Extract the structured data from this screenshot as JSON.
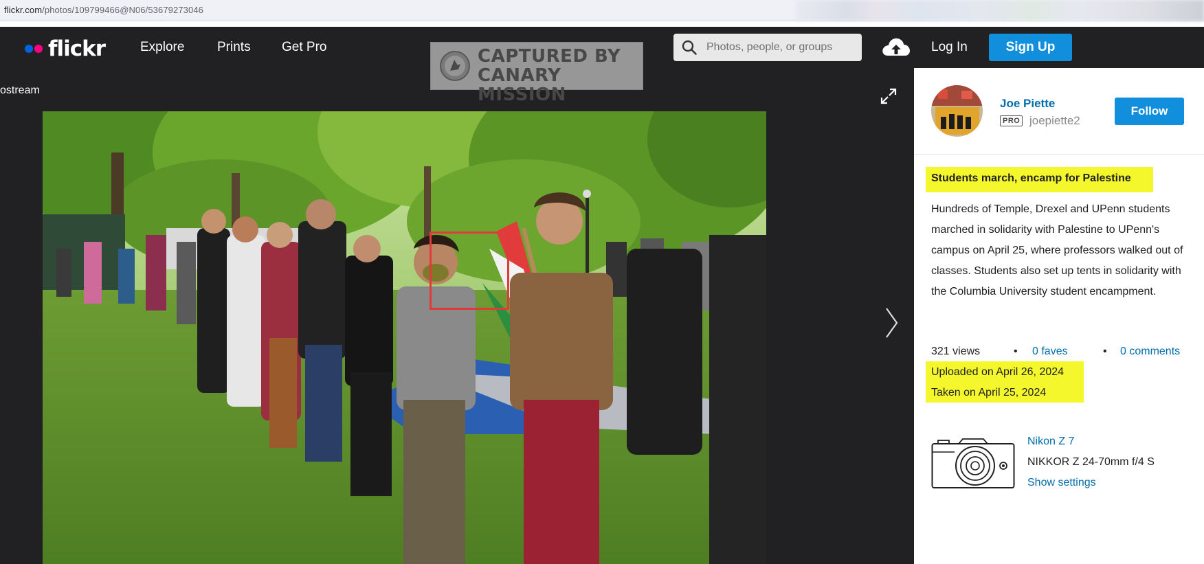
{
  "address_bar": {
    "host": "flickr.com",
    "path": "/photos/109799466@N06/53679273046"
  },
  "nav": {
    "logo_text": "flickr",
    "explore": "Explore",
    "prints": "Prints",
    "get_pro": "Get Pro",
    "search_placeholder": "Photos, people, or groups",
    "log_in": "Log In",
    "sign_up": "Sign Up",
    "brand_colors": {
      "blue": "#0063dc",
      "pink": "#ff0084",
      "button": "#128fdc"
    }
  },
  "watermark": {
    "line1": "CAPTURED BY",
    "line2": "CANARY MISSION"
  },
  "stage": {
    "back_link": "ostream",
    "icons": [
      "expand-icon",
      "chevron-right-icon"
    ]
  },
  "owner": {
    "name": "Joe Piette",
    "badge": "PRO",
    "handle": "joepiette2",
    "follow": "Follow"
  },
  "photo": {
    "title": "Students march, encamp for Palestine",
    "description": "Hundreds of Temple, Drexel and UPenn students marched in solidarity with Palestine to UPenn's campus on April 25, where professors walked out of classes. Students also set up tents in solidarity with the Columbia University student encampment.",
    "views": "321 views",
    "separator": "•",
    "faves": "0 faves",
    "comments": "0 comments",
    "uploaded": "Uploaded on April 26, 2024",
    "taken": "Taken on April 25, 2024",
    "highlight_color": "#f5f72d",
    "facebox_color": "#e23a3a"
  },
  "exif": {
    "camera": "Nikon Z 7",
    "lens": "NIKKOR Z 24-70mm f/4 S",
    "show_settings": "Show settings"
  }
}
